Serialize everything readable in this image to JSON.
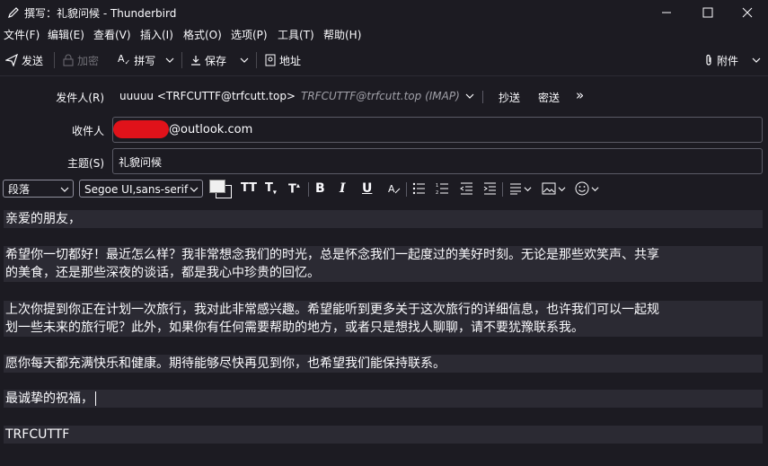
{
  "window": {
    "title": "撰写：礼貌问候 - Thunderbird",
    "minimize_icon": "minimize-icon",
    "maximize_icon": "maximize-icon",
    "close_icon": "close-icon"
  },
  "menu": [
    "文件(F)",
    "编辑(E)",
    "查看(V)",
    "插入(I)",
    "格式(O)",
    "选项(P)",
    "工具(T)",
    "帮助(H)"
  ],
  "toolbar": {
    "send": "发送",
    "encrypt": "加密",
    "spell": "拼写",
    "save": "保存",
    "address": "地址",
    "attach": "附件"
  },
  "header": {
    "from_label": "发件人(R)",
    "from_value": "uuuuu <TRFCUTTF@trfcutt.top>",
    "from_account": "TRFCUTTF@trfcutt.top (IMAP)",
    "cc": "抄送",
    "bcc": "密送",
    "more": "»",
    "to_label": "收件人",
    "to_value": "@outlook.com",
    "subject_label": "主题(S)",
    "subject_value": "礼貌问候"
  },
  "format": {
    "paragraph": "段落",
    "font": "Segoe UI,sans-serif"
  },
  "body": {
    "lines": [
      "亲爱的朋友，",
      "",
      "希望你一切都好！最近怎么样？我非常想念我们的时光，总是怀念我们一起度过的美好时刻。无论是那些欢笑声、共享",
      "的美食，还是那些深夜的谈话，都是我心中珍贵的回忆。",
      "",
      "上次你提到你正在计划一次旅行，我对此非常感兴趣。希望能听到更多关于这次旅行的详细信息，也许我们可以一起规",
      "划一些未来的旅行呢？此外，如果你有任何需要帮助的地方，或者只是想找人聊聊，请不要犹豫联系我。",
      "",
      "愿你每天都充满快乐和健康。期待能够尽快再见到你，也希望我们能保持联系。",
      "",
      "最诚挚的祝福，",
      "",
      "TRFCUTTF"
    ]
  },
  "colors": {
    "background": "#1c1b22",
    "line_bg": "#2b2a33",
    "redaction": "#e0121a",
    "border": "#5b5b66"
  }
}
